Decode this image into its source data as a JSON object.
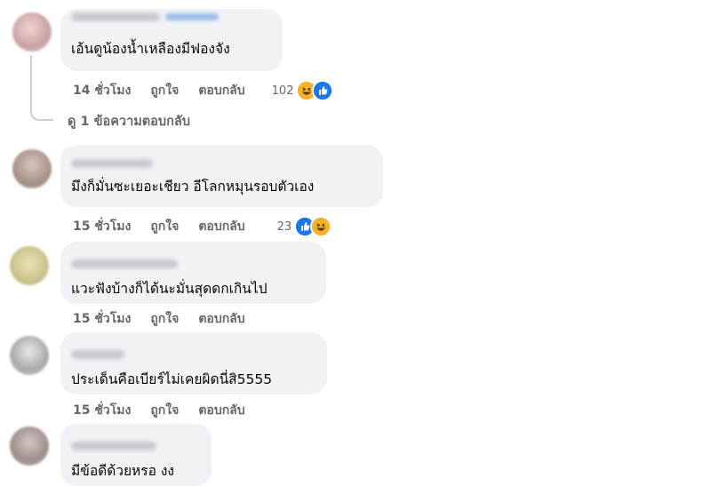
{
  "actions": {
    "like": "ถูกใจ",
    "reply": "ตอบกลับ"
  },
  "view_replies": "ดู 1 ข้อความตอบกลับ",
  "colors": {
    "like": "#1877f2",
    "haha": "#f7b125",
    "meta": "#65676b",
    "bubble": "#f0f2f5"
  },
  "comments": [
    {
      "text": "เอ้นดูน้องน้ำเหลืองมีฟองจัง",
      "time": "14 ชั่วโมง",
      "reaction_count": "102",
      "reactions": [
        "haha-icon",
        "like-icon"
      ]
    },
    {
      "text": "มึงก็มั่นซะเยอะเชียว อีโลกหมุนรอบตัวเอง",
      "time": "15 ชั่วโมง",
      "reaction_count": "23",
      "reactions": [
        "like-icon",
        "haha-icon"
      ]
    },
    {
      "text": "แวะฟังบ้างก็ได้นะมั่นสุดดกเกินไป",
      "time": "15 ชั่วโมง"
    },
    {
      "text": "ประเด็นคือเบียร์ไม่เคยผิดนี่สิ5555",
      "time": "15 ชั่วโมง"
    },
    {
      "text": "มีข้อดีด้วยหรอ งง"
    }
  ]
}
